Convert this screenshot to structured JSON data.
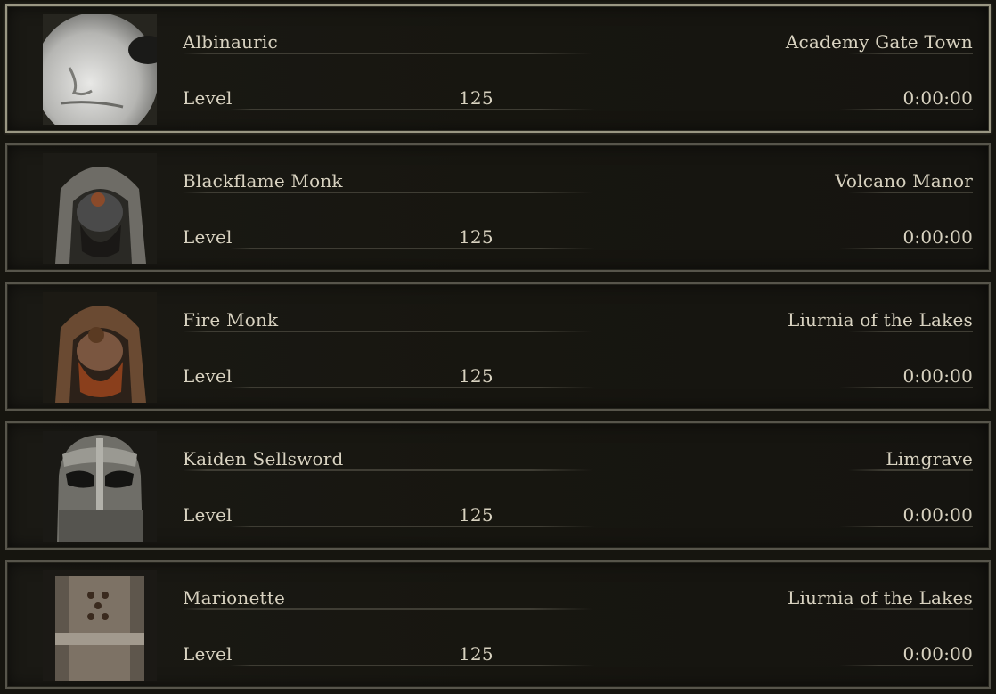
{
  "slots": [
    {
      "name": "Albinauric",
      "location": "Academy Gate Town",
      "level_label": "Level",
      "level": "125",
      "playtime": "0:00:00",
      "portrait_icon": "albinauric-face-icon",
      "selected": true
    },
    {
      "name": "Blackflame Monk",
      "location": "Volcano Manor",
      "level_label": "Level",
      "level": "125",
      "playtime": "0:00:00",
      "portrait_icon": "hooded-monk-icon",
      "selected": false
    },
    {
      "name": "Fire Monk",
      "location": "Liurnia of the Lakes",
      "level_label": "Level",
      "level": "125",
      "playtime": "0:00:00",
      "portrait_icon": "fire-monk-icon",
      "selected": false
    },
    {
      "name": "Kaiden Sellsword",
      "location": "Limgrave",
      "level_label": "Level",
      "level": "125",
      "playtime": "0:00:00",
      "portrait_icon": "knight-helm-icon",
      "selected": false
    },
    {
      "name": "Marionette",
      "location": "Liurnia of the Lakes",
      "level_label": "Level",
      "level": "125",
      "playtime": "0:00:00",
      "portrait_icon": "iron-mask-icon",
      "selected": false
    }
  ],
  "colors": {
    "background": "#16150f",
    "text": "#d8d2c0",
    "border": "#57554b",
    "border_selected": "#9a9783"
  }
}
